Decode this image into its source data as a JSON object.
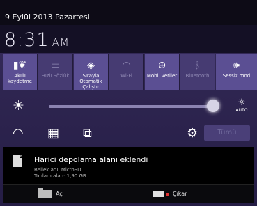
{
  "status": {
    "date": "9 Eylül 2013 Pazartesi"
  },
  "clock": {
    "time": "8:31",
    "ampm": "AM"
  },
  "tiles": [
    {
      "label": "Akıllı kaydetme",
      "icon": "smart-save-icon",
      "state": "on"
    },
    {
      "label": "Hızlı Sözlük",
      "icon": "dictionary-icon",
      "state": "off"
    },
    {
      "label": "Sırayla Otomatik Çalıştır",
      "icon": "auto-rotate-icon",
      "state": "on"
    },
    {
      "label": "Wi-Fi",
      "icon": "wifi-icon",
      "state": "off"
    },
    {
      "label": "Mobil veriler",
      "icon": "mobile-data-icon",
      "state": "on"
    },
    {
      "label": "Bluetooth",
      "icon": "bluetooth-icon",
      "state": "off"
    },
    {
      "label": "Sessiz mod",
      "icon": "silent-mode-icon",
      "state": "on"
    }
  ],
  "brightness": {
    "level_percent": 96,
    "auto_label": "AUTO"
  },
  "quick": {
    "all_label": "Tümü"
  },
  "notification": {
    "title": "Harici depolama alanı eklendi",
    "line1": "Bellek adı: MicroSD",
    "line2": "Toplam alan: 1,90 GB",
    "actions": {
      "open": "Aç",
      "eject": "Çıkar"
    }
  },
  "colors": {
    "shade_bg": "#2e2550",
    "tile_on": "#5b4f93",
    "tile_off": "#463b72"
  }
}
